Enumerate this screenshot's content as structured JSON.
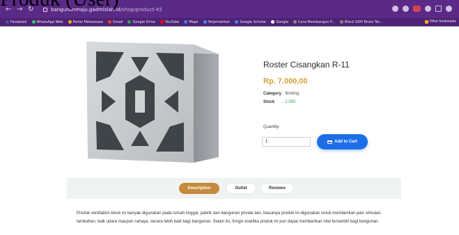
{
  "caption": "Produk (User)",
  "browser": {
    "url_domain": "bangunanmaju.gadmislah.id",
    "url_path": "/shop/product-45",
    "bookmarks": [
      {
        "label": "Facebook",
        "color": "#3b5998"
      },
      {
        "label": "WhatsApp Web",
        "color": "#25d366"
      },
      {
        "label": "Portal Mahasiswa",
        "color": "#f0b400"
      },
      {
        "label": "Gmail",
        "color": "#ea4335"
      },
      {
        "label": "Google Drive",
        "color": "#34a853"
      },
      {
        "label": "YouTube",
        "color": "#ff0000"
      },
      {
        "label": "Maps",
        "color": "#4285f4"
      },
      {
        "label": "Terjemahkan",
        "color": "#4285f4"
      },
      {
        "label": "Google Scholar",
        "color": "#4285f4"
      },
      {
        "label": "Google",
        "color": "#ffffff"
      },
      {
        "label": "Cara Membangun P...",
        "color": "#888888"
      },
      {
        "label": "Block SDH Bruto Ter...",
        "color": "#888888"
      }
    ],
    "other_bookmarks": "Other bookmarks"
  },
  "product": {
    "title": "Roster Cisangkan R-11",
    "price": "Rp. 7.000,00",
    "category_label": "Category",
    "category_value": ": Binding",
    "stock_label": "Stock",
    "stock_value": ": 2.000"
  },
  "cart": {
    "quantity_label": "Quantity:",
    "quantity_value": "1",
    "add_label": "Add to Cart"
  },
  "tabs": [
    "Description",
    "Outlet",
    "Reviews"
  ],
  "description": "Produk ventilation block ini banyak digunakan pada rumah tinggal, pabrik dan bangunan private lain, biasanya produk ini digunakan untuk memberikan jalur sirkulasi tambahan, baik udara maupun cahaya, secara lebih baik bagi bangunan. Selain itu, fungsi estetika produk ini pun dapat memberikan nilai tersendiri bagi bangunan.",
  "colors": {
    "browser_bg": "#5b2a86",
    "price": "#d4a237",
    "stock": "#26a04a",
    "button": "#1d6ee6",
    "tab_active": "#c58a3b"
  }
}
